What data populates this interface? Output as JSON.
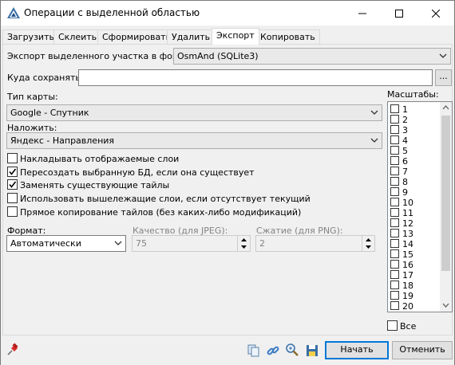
{
  "window": {
    "title": "Операции с выделенной областью"
  },
  "tabs": [
    "Загрузить",
    "Склеить",
    "Сформировать",
    "Удалить",
    "Экспорт",
    "Копировать"
  ],
  "active_tab": "Экспорт",
  "export": {
    "format_label": "Экспорт выделенного участка в формат",
    "format_value": "OsmAnd (SQLite3)",
    "save_label": "Куда сохранять:",
    "save_value": "",
    "browse_label": "...",
    "map_type_label": "Тип карты:",
    "map_type_value": "Google - Спутник",
    "overlay_label": "Наложить:",
    "overlay_value": "Яндекс - Направления",
    "options": [
      {
        "label": "Накладывать отображаемые слои",
        "checked": false
      },
      {
        "label": "Пересоздать выбранную БД, если она существует",
        "checked": true
      },
      {
        "label": "Заменять существующие тайлы",
        "checked": true
      },
      {
        "label": "Использовать вышележащие слои, если отсутствует текущий",
        "checked": false
      },
      {
        "label": "Прямое копирование тайлов (без каких-либо модификаций)",
        "checked": false
      }
    ],
    "image_format_label": "Формат:",
    "image_format_value": "Автоматически",
    "jpeg_quality_label": "Качество (для JPEG):",
    "jpeg_quality_value": "75",
    "png_compression_label": "Сжатие (для PNG):",
    "png_compression_value": "2"
  },
  "scales": {
    "label": "Масштабы:",
    "items": [
      "1",
      "2",
      "3",
      "4",
      "5",
      "6",
      "7",
      "8",
      "9",
      "10",
      "11",
      "12",
      "13",
      "14",
      "15",
      "16",
      "17",
      "18",
      "19",
      "20"
    ],
    "all_label": "Все"
  },
  "footer": {
    "start_label": "Начать",
    "cancel_label": "Отменить"
  },
  "colors": {
    "accent": "#0078d7",
    "check": "#000000"
  }
}
